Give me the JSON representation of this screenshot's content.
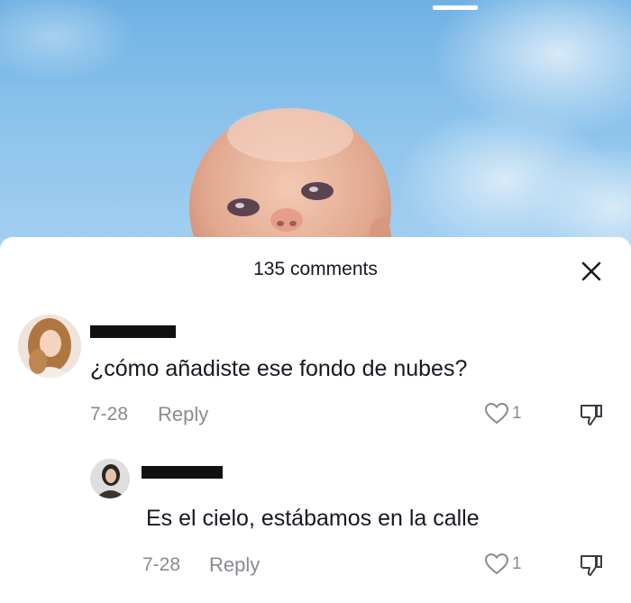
{
  "sheet": {
    "title": "135 comments"
  },
  "comments": [
    {
      "text": "¿cómo añadiste ese fondo de nubes?",
      "date": "7-28",
      "reply_label": "Reply",
      "likes": "1"
    },
    {
      "text": "Es el cielo, estábamos en la calle",
      "date": "7-28",
      "reply_label": "Reply",
      "likes": "1"
    }
  ],
  "icons": {
    "close": "close-icon",
    "like": "heart-icon",
    "dislike": "thumbs-down-icon"
  },
  "colors": {
    "sky": "#8cc3ec",
    "text": "#161823",
    "muted": "#8a8b91"
  }
}
